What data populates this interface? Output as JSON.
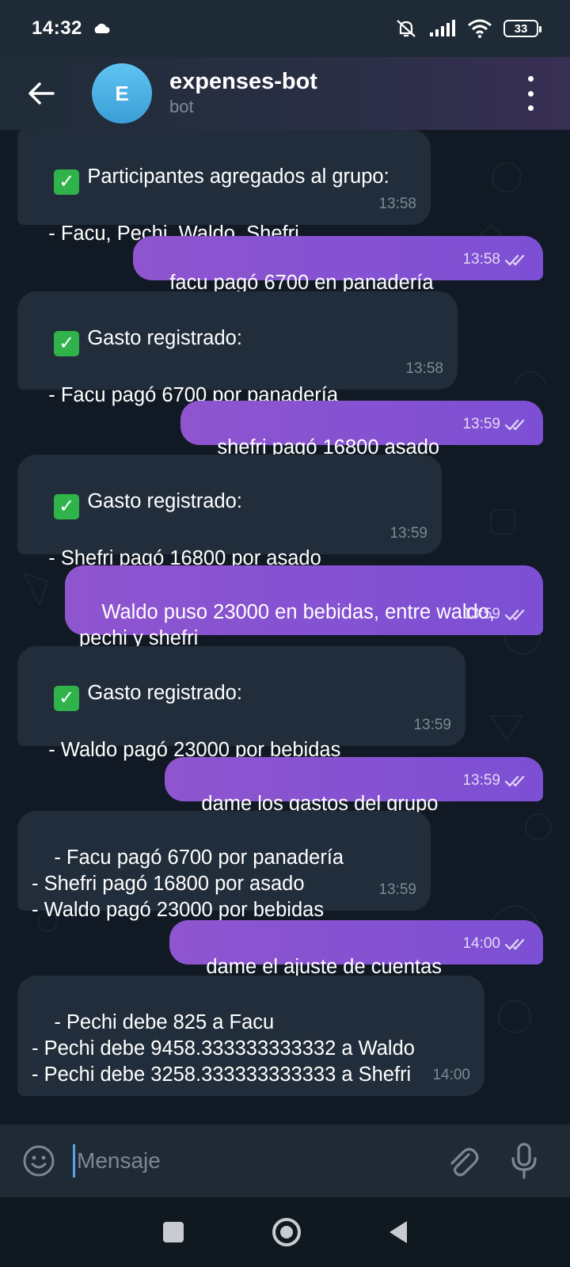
{
  "status_bar": {
    "time": "14:32",
    "battery": "33"
  },
  "header": {
    "avatar_letter": "E",
    "title": "expenses-bot",
    "subtitle": "bot"
  },
  "messages": [
    {
      "direction": "in",
      "check": true,
      "text": "Participantes agregados al grupo:\n\n   - Facu, Pechi, Waldo, Shefri",
      "time": "13:58"
    },
    {
      "direction": "out",
      "text": "facu pagó 6700 en panadería",
      "time": "13:58"
    },
    {
      "direction": "in",
      "check": true,
      "text": "Gasto registrado:\n\n   - Facu pagó 6700 por panadería",
      "time": "13:58"
    },
    {
      "direction": "out",
      "text": "shefri pagó 16800 asado",
      "time": "13:59"
    },
    {
      "direction": "in",
      "check": true,
      "text": "Gasto registrado:\n\n   - Shefri pagó 16800 por asado",
      "time": "13:59"
    },
    {
      "direction": "out",
      "text": "Waldo puso 23000 en bebidas, entre waldo,\npechi y shefri",
      "time": "13:59"
    },
    {
      "direction": "in",
      "check": true,
      "text": "Gasto registrado:\n\n   - Waldo pagó 23000 por bebidas",
      "time": "13:59"
    },
    {
      "direction": "out",
      "text": "dame los gastos del grupo",
      "time": "13:59"
    },
    {
      "direction": "in",
      "check": false,
      "text": "- Facu pagó 6700 por panadería\n- Shefri pagó 16800 por asado\n- Waldo pagó 23000 por bebidas",
      "time": "13:59"
    },
    {
      "direction": "out",
      "text": "dame el ajuste de cuentas",
      "time": "14:00"
    },
    {
      "direction": "in",
      "check": false,
      "text": "- Pechi debe 825 a Facu\n- Pechi debe 9458.333333333332 a Waldo\n- Pechi debe 3258.333333333333 a Shefri",
      "time": "14:00"
    }
  ],
  "input": {
    "placeholder": "Mensaje"
  },
  "icons": {
    "back": "arrow-left-icon",
    "menu": "more-vert-icon",
    "emoji": "emoji-icon",
    "attach": "paperclip-icon",
    "mic": "microphone-icon"
  },
  "colors": {
    "incoming_bubble": "#212d3a",
    "outgoing_bubble": "#8552d1",
    "check_green": "#2fb34a",
    "caret": "#5ba3e8"
  }
}
